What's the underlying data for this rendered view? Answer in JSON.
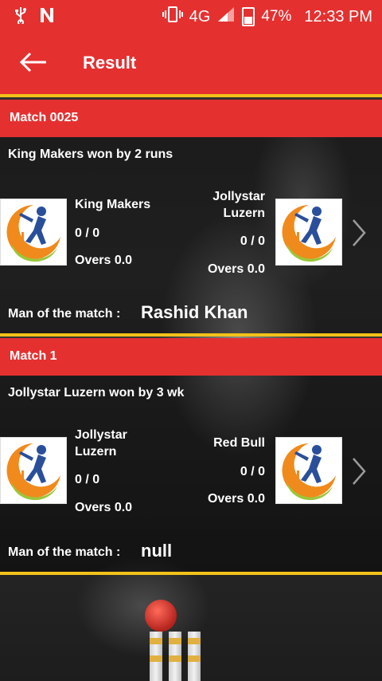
{
  "status_bar": {
    "network": "4G",
    "network_sup": "4G",
    "battery": "47%",
    "time": "12:33 PM",
    "icons": [
      "usb-icon",
      "n-icon",
      "vibrate-icon",
      "signal-icon",
      "battery-icon"
    ]
  },
  "app_bar": {
    "title": "Result",
    "back_icon": "arrow-left-icon"
  },
  "colors": {
    "primary": "#e53030",
    "accent": "#f2c21a"
  },
  "matches": [
    {
      "title": "Match 0025",
      "result": "King Makers won by 2 runs",
      "team1": {
        "name": "King Makers",
        "score": "0 / 0",
        "overs": "Overs 0.0"
      },
      "team2": {
        "name_line1": "Jollystar",
        "name_line2": "Luzern",
        "score": "0 / 0",
        "overs": "Overs 0.0"
      },
      "man_of_match_label": "Man of the match :",
      "man_of_match": "Rashid Khan"
    },
    {
      "title": "Match 1",
      "result": "Jollystar Luzern won by 3 wk",
      "team1": {
        "name_line1": "Jollystar",
        "name_line2": "Luzern",
        "score": "0 / 0",
        "overs": "Overs 0.0"
      },
      "team2": {
        "name": "Red Bull",
        "score": "0 / 0",
        "overs": "Overs 0.0"
      },
      "man_of_match_label": "Man of the match :",
      "man_of_match": "null"
    }
  ]
}
